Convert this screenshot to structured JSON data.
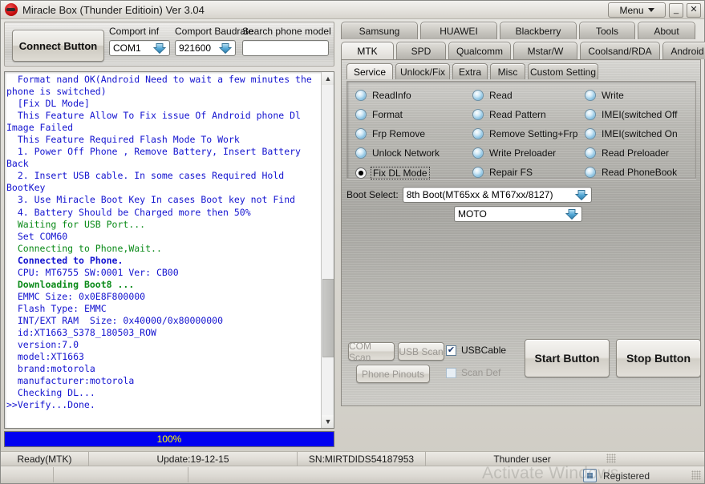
{
  "window": {
    "title": "Miracle Box (Thunder Editioin) Ver 3.04",
    "logo_icon": "miracle-box-logo-icon",
    "menu_label": "Menu",
    "minimize_label": "_",
    "close_label": "✕"
  },
  "toolbar": {
    "connect_label": "Connect Button",
    "comport_inf_label": "Comport inf",
    "comport_inf_value": "COM1",
    "baudrate_label": "Comport Baudrate",
    "baudrate_value": "921600",
    "search_label": "Search phone model",
    "search_value": "",
    "search_placeholder": ""
  },
  "log": {
    "lines": [
      {
        "text": "  Format nand OK(Android Need to wait a few minutes the phone is switched)",
        "color": "blue",
        "bold": false
      },
      {
        "text": "  [Fix DL Mode]",
        "color": "blue",
        "bold": false
      },
      {
        "text": "  This Feature Allow To Fix issue Of Android phone Dl Image Failed",
        "color": "blue",
        "bold": false
      },
      {
        "text": "  This Feature Required Flash Mode To Work",
        "color": "blue",
        "bold": false
      },
      {
        "text": "  1. Power Off Phone , Remove Battery, Insert Battery Back",
        "color": "blue",
        "bold": false
      },
      {
        "text": "  2. Insert USB cable. In some cases Required Hold BootKey",
        "color": "blue",
        "bold": false
      },
      {
        "text": "  3. Use Miracle Boot Key In cases Boot key not Find",
        "color": "blue",
        "bold": false
      },
      {
        "text": "  4. Battery Should be Charged more then 50%",
        "color": "blue",
        "bold": false
      },
      {
        "text": "  Waiting for USB Port...",
        "color": "green",
        "bold": false
      },
      {
        "text": "  Set COM60",
        "color": "blue",
        "bold": false
      },
      {
        "text": "  Connecting to Phone,Wait..",
        "color": "green",
        "bold": false
      },
      {
        "text": "  Connected to Phone.",
        "color": "blue",
        "bold": true
      },
      {
        "text": "  CPU: MT6755 SW:0001 Ver: CB00",
        "color": "blue",
        "bold": false
      },
      {
        "text": "  Downloading Boot8 ...",
        "color": "green",
        "bold": true
      },
      {
        "text": "  EMMC Size: 0x0E8F800000",
        "color": "blue",
        "bold": false
      },
      {
        "text": "  Flash Type: EMMC",
        "color": "blue",
        "bold": false
      },
      {
        "text": "  INT/EXT RAM  Size: 0x40000/0x80000000",
        "color": "blue",
        "bold": false
      },
      {
        "text": "  id:XT1663_S378_180503_ROW",
        "color": "blue",
        "bold": false
      },
      {
        "text": "  version:7.0",
        "color": "blue",
        "bold": false
      },
      {
        "text": "  model:XT1663",
        "color": "blue",
        "bold": false
      },
      {
        "text": "  brand:motorola",
        "color": "blue",
        "bold": false
      },
      {
        "text": "  manufacturer:motorola",
        "color": "blue",
        "bold": false
      },
      {
        "text": "  Checking DL...",
        "color": "blue",
        "bold": false
      },
      {
        "text": ">>Verify...Done.",
        "color": "blue",
        "bold": false
      }
    ],
    "scroll_up_icon": "chevron-up-icon",
    "scroll_down_icon": "chevron-down-icon"
  },
  "progress": {
    "value": 100,
    "label": "100%"
  },
  "status": {
    "left": "Ready(MTK)",
    "update": "Update:19-12-15",
    "sn": "SN:MIRTDIDS54187953",
    "user": "Thunder user",
    "registered": "Registered",
    "registered_icon": "license-card-icon",
    "watermark": "Activate Windows"
  },
  "tabs": {
    "brand_row": [
      {
        "label": "Samsung",
        "active": false
      },
      {
        "label": "HUAWEI",
        "active": false
      },
      {
        "label": "Blackberry",
        "active": false
      },
      {
        "label": "Tools",
        "active": false
      },
      {
        "label": "About",
        "active": false
      }
    ],
    "chipset_row": [
      {
        "label": "MTK",
        "active": true
      },
      {
        "label": "SPD",
        "active": false
      },
      {
        "label": "Qualcomm",
        "active": false
      },
      {
        "label": "Mstar/W",
        "active": false
      },
      {
        "label": "Coolsand/RDA",
        "active": false
      },
      {
        "label": "Android",
        "active": false
      }
    ],
    "function_row": [
      {
        "label": "Service",
        "active": true
      },
      {
        "label": "Unlock/Fix",
        "active": false
      },
      {
        "label": "Extra",
        "active": false
      },
      {
        "label": "Misc",
        "active": false
      },
      {
        "label": "Custom Setting",
        "active": false
      }
    ]
  },
  "operations": {
    "column1": [
      {
        "label": "ReadInfo",
        "selected": false
      },
      {
        "label": "Format",
        "selected": false
      },
      {
        "label": "Frp Remove",
        "selected": false
      },
      {
        "label": "Unlock Network",
        "selected": false
      },
      {
        "label": "Fix DL Mode",
        "selected": true
      }
    ],
    "column2": [
      {
        "label": "Read",
        "selected": false
      },
      {
        "label": "Read Pattern",
        "selected": false
      },
      {
        "label": "Remove Setting+Frp",
        "selected": false
      },
      {
        "label": "Write Preloader",
        "selected": false
      },
      {
        "label": "Repair FS",
        "selected": false
      }
    ],
    "column3": [
      {
        "label": "Write",
        "selected": false
      },
      {
        "label": "IMEI(switched Off",
        "selected": false
      },
      {
        "label": "IMEI(switched On",
        "selected": false
      },
      {
        "label": "Read Preloader",
        "selected": false
      },
      {
        "label": "Read PhoneBook",
        "selected": false
      }
    ]
  },
  "boot": {
    "label": "Boot Select:",
    "boot_value": "8th Boot(MT65xx & MT67xx/8127)",
    "brand_value": "MOTO"
  },
  "actions": {
    "com_scan": "COM Scan",
    "usb_scan": "USB Scan",
    "phone_pinouts": "Phone Pinouts",
    "usb_cable_label": "USBCable",
    "usb_cable_checked": true,
    "scan_def_label": "Scan Def",
    "scan_def_checked": false,
    "start": "Start Button",
    "stop": "Stop Button"
  },
  "colors": {
    "log_blue": "#1414d0",
    "log_green": "#0a8a18",
    "progress_bg": "#0000f0",
    "progress_text": "#ffff00"
  }
}
